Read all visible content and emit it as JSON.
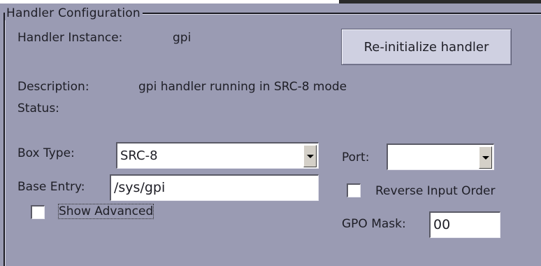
{
  "group": {
    "title": "Handler Configuration"
  },
  "instance": {
    "label": "Handler Instance:",
    "value": "gpi"
  },
  "reinit_button": {
    "label": "Re-initialize handler"
  },
  "description": {
    "label": "Description:",
    "value": "gpi handler running in SRC-8 mode"
  },
  "status": {
    "label": "Status:",
    "value": ""
  },
  "box_type": {
    "label": "Box Type:",
    "selected": "SRC-8"
  },
  "port": {
    "label": "Port:",
    "selected": ""
  },
  "base_entry": {
    "label": "Base Entry:",
    "value": "/sys/gpi"
  },
  "reverse_input_order": {
    "label": "Reverse Input Order",
    "checked": false
  },
  "show_advanced": {
    "label": "Show Advanced",
    "checked": false
  },
  "gpo_mask": {
    "label": "GPO Mask:",
    "value": "00"
  }
}
